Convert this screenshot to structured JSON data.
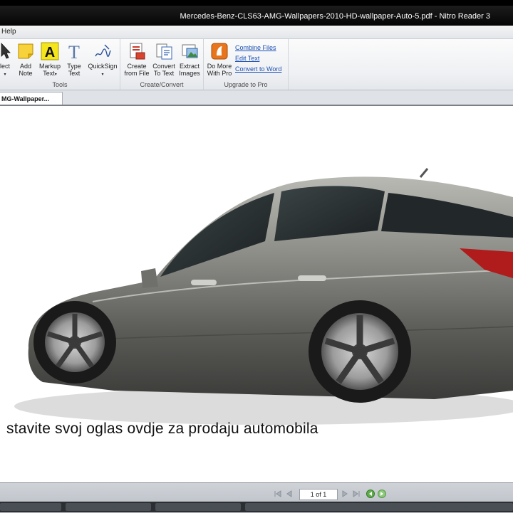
{
  "window": {
    "title": "Mercedes-Benz-CLS63-AMG-Wallpapers-2010-HD-wallpaper-Auto-5.pdf - Nitro Reader 3"
  },
  "menu": {
    "items": [
      "Help"
    ]
  },
  "ribbon": {
    "tools": {
      "label": "Tools",
      "select_label": "lect",
      "add_note_label": "Add\nNote",
      "markup_text_label": "Markup\nText",
      "type_text_label": "Type\nText",
      "quicksign_label": "QuickSign"
    },
    "create_convert": {
      "label": "Create/Convert",
      "create_from_file_label": "Create\nfrom File",
      "convert_to_text_label": "Convert\nTo Text",
      "extract_images_label": "Extract\nImages"
    },
    "upgrade": {
      "label": "Upgrade to Pro",
      "do_more_label": "Do More\nWith Pro",
      "combine_files": "Combine Files",
      "edit_text": "Edit Text",
      "convert_to_word": "Convert to Word"
    }
  },
  "tabs": {
    "document_tab": "MG-Wallpaper..."
  },
  "document": {
    "caption": "stavite svoj oglas ovdje za prodaju automobila"
  },
  "status": {
    "page_indicator": "1 of 1"
  },
  "colors": {
    "link": "#1b4fb3",
    "titlebar": "#0a0a0a",
    "ribbon": "#eef0f3"
  }
}
